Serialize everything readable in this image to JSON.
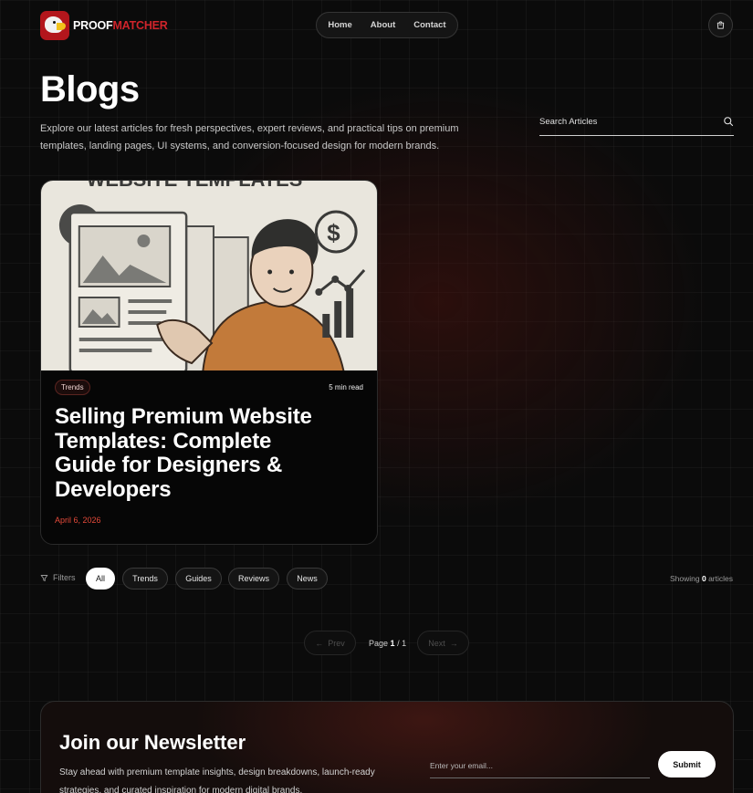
{
  "header": {
    "logo_text_1": "PROOF",
    "logo_text_2": "MATCHER",
    "nav": [
      "Home",
      "About",
      "Contact"
    ],
    "cart_icon": "shopping-bag-icon"
  },
  "hero": {
    "title": "Blogs",
    "intro": "Explore our latest articles for fresh perspectives, expert reviews, and practical tips on premium templates, landing pages, UI systems, and conversion-focused design for modern brands.",
    "search_placeholder": "Search Articles",
    "search_icon": "search-icon"
  },
  "posts": [
    {
      "image_text": "WEBSITE TEMPLATES",
      "tag": "Trends",
      "read_time": "5 min read",
      "title": "Selling Premium Website Templates: Complete Guide for Designers & Developers",
      "date": "April 6, 2026"
    }
  ],
  "filters": {
    "label": "Filters",
    "chips": [
      "All",
      "Trends",
      "Guides",
      "Reviews",
      "News"
    ],
    "active": "All",
    "showing_prefix": "Showing",
    "showing_count": "0",
    "showing_suffix": "articles"
  },
  "pagination": {
    "prev": "Prev",
    "next": "Next",
    "page_label": "Page",
    "current": "1",
    "total": "/ 1"
  },
  "newsletter": {
    "title": "Join our Newsletter",
    "text": "Stay ahead with premium template insights, design breakdowns, launch-ready strategies, and curated inspiration for modern digital brands.",
    "email_placeholder": "Enter your email...",
    "submit": "Submit"
  },
  "colors": {
    "accent": "#d0242b",
    "date": "#e44a3a",
    "background": "#0b0b0b"
  }
}
